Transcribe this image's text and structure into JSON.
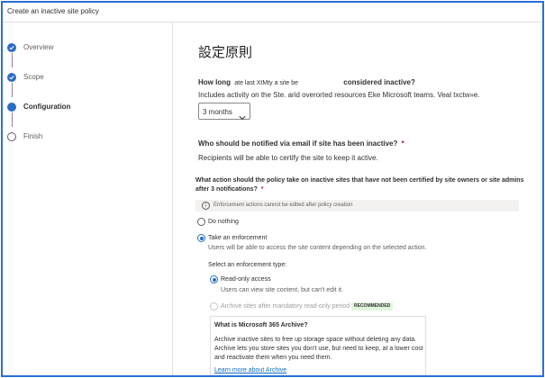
{
  "window": {
    "title": "Create an inactive site policy"
  },
  "sidebar": {
    "steps": [
      {
        "label": "Overview",
        "state": "done"
      },
      {
        "label": "Scope",
        "state": "done"
      },
      {
        "label": "Configuration",
        "state": "current"
      },
      {
        "label": "Finish",
        "state": "todo"
      }
    ]
  },
  "main": {
    "heading": "設定原則",
    "q1": {
      "label_a": "How long",
      "label_b": "ate last XtMty a site be",
      "label_c": "considered inactive?",
      "help": "Includes activity on the Ste. arid overorted resources Eke Microsoft teams. Veal txctw»e.",
      "dropdown_value": "3 months"
    },
    "q2": {
      "label": "Who should be notified via email if site has been inactive?",
      "required_mark": "*",
      "help": "Recipients will be able to certify the site to keep it active."
    },
    "q3": {
      "label_line1": "What action should the policy take on inactive sites that have not been certified by site owners or site admins",
      "label_line2": "after 3 notifications?",
      "required_mark": "*",
      "banner": "Enforcement actions cannot be edited after policy creation",
      "options": {
        "do_nothing": "Do nothing",
        "take_enforcement": "Take an enforcement",
        "take_enforcement_help": "Users will be able to access the site content depending on the selected action."
      },
      "enforcement": {
        "label": "Select an enforcement type:",
        "read_only": "Read-only access",
        "read_only_help": "Users can view site content, but can't edit it.",
        "archive": "Archive sites after mandatory read-only period",
        "badge": "RECOMMENDED"
      },
      "archive_card": {
        "title": "What is Microsoft 365 Archive?",
        "body": "Archive inactive sites to free up storage space without deleting any data. Archive lets you store sites you don't use, but need to keep, at a lower cost and reactivate them when you need them.",
        "link": "Learn more about Archive"
      }
    }
  },
  "colors": {
    "accent": "#2b6cc4",
    "frame": "#2a6fd6",
    "badge_bg": "#dff6dd",
    "link": "#0f6cbd"
  },
  "icons": [
    "check-icon",
    "chevron-down-icon",
    "info-icon"
  ]
}
